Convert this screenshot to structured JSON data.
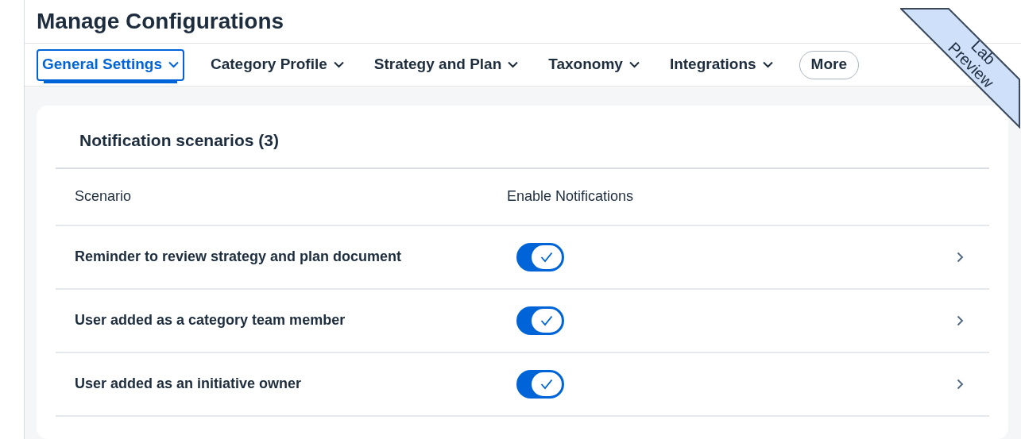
{
  "page": {
    "title": "Manage Configurations"
  },
  "tabs": [
    {
      "label": "General Settings",
      "selected": true,
      "kind": "menu"
    },
    {
      "label": "Category Profile",
      "selected": false,
      "kind": "menu"
    },
    {
      "label": "Strategy and Plan",
      "selected": false,
      "kind": "menu"
    },
    {
      "label": "Taxonomy",
      "selected": false,
      "kind": "menu"
    },
    {
      "label": "Integrations",
      "selected": false,
      "kind": "menu"
    },
    {
      "label": "More",
      "selected": false,
      "kind": "more"
    }
  ],
  "ribbon": {
    "lines": [
      "Lab",
      "Preview"
    ]
  },
  "table": {
    "title": "Notification scenarios (3)",
    "columns": [
      "Scenario",
      "Enable Notifications"
    ],
    "rows": [
      {
        "scenario": "Reminder to review strategy and plan document",
        "on": true
      },
      {
        "scenario": "User added as a category team member",
        "on": true
      },
      {
        "scenario": "User added as an initiative owner",
        "on": true
      }
    ]
  }
}
